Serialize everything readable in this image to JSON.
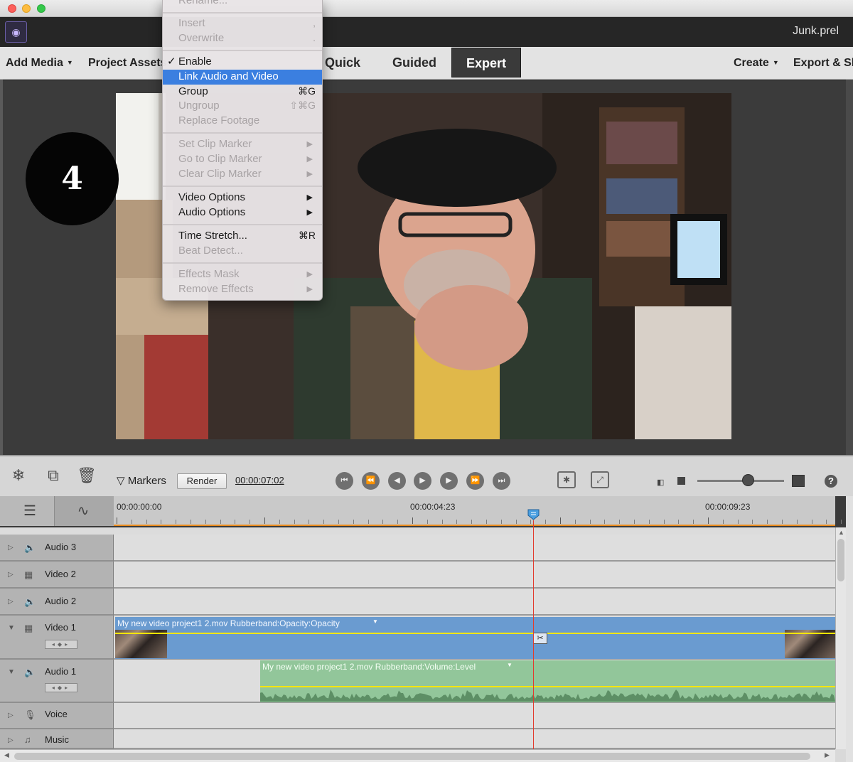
{
  "window": {
    "project_name": "Junk.prel"
  },
  "menubar": {
    "add_media": "Add Media",
    "project_assets": "Project Assets",
    "modes": [
      "Quick",
      "Guided",
      "Expert"
    ],
    "active_mode": "Expert",
    "create": "Create",
    "export": "Export & Share"
  },
  "step_badge": "4",
  "context_menu": {
    "items": [
      {
        "label": "Rename...",
        "shortcut": "",
        "enabled": false
      },
      {
        "label": "Insert",
        "shortcut": ",",
        "enabled": false
      },
      {
        "label": "Overwrite",
        "shortcut": ".",
        "enabled": false
      },
      {
        "label": "Enable",
        "shortcut": "",
        "enabled": true,
        "checked": true
      },
      {
        "label": "Link Audio and Video",
        "shortcut": "",
        "enabled": true,
        "highlighted": true
      },
      {
        "label": "Group",
        "shortcut": "⌘G",
        "enabled": true
      },
      {
        "label": "Ungroup",
        "shortcut": "⇧⌘G",
        "enabled": false
      },
      {
        "label": "Replace Footage",
        "shortcut": "",
        "enabled": false
      },
      {
        "label": "Set Clip Marker",
        "submenu": true,
        "enabled": false
      },
      {
        "label": "Go to Clip Marker",
        "submenu": true,
        "enabled": false
      },
      {
        "label": "Clear Clip Marker",
        "submenu": true,
        "enabled": false
      },
      {
        "label": "Video Options",
        "submenu": true,
        "enabled": true
      },
      {
        "label": "Audio Options",
        "submenu": true,
        "enabled": true
      },
      {
        "label": "Time Stretch...",
        "shortcut": "⌘R",
        "enabled": true
      },
      {
        "label": "Beat Detect...",
        "shortcut": "",
        "enabled": false
      },
      {
        "label": "Effects Mask",
        "submenu": true,
        "enabled": false
      },
      {
        "label": "Remove Effects",
        "submenu": true,
        "enabled": false
      }
    ]
  },
  "controls": {
    "markers_label": "Markers",
    "render_label": "Render",
    "timecode": "00:00:07:02",
    "zoom_level": 0.58
  },
  "ruler": {
    "labels": [
      "00:00:00:00",
      "00:00:04:23",
      "00:00:09:23"
    ]
  },
  "tracks": [
    {
      "name": "Audio 3",
      "kind": "audio"
    },
    {
      "name": "Video 2",
      "kind": "video"
    },
    {
      "name": "Audio 2",
      "kind": "audio"
    },
    {
      "name": "Video 1",
      "kind": "video",
      "expanded": true
    },
    {
      "name": "Audio 1",
      "kind": "audio",
      "expanded": true
    },
    {
      "name": "Voice",
      "kind": "voice"
    },
    {
      "name": "Music",
      "kind": "music"
    }
  ],
  "clips": {
    "video_title": "My new video project1 2.mov Rubberband:Opacity:Opacity",
    "audio_title": "My new video project1 2.mov Rubberband:Volume:Level"
  },
  "icons": {
    "app_logo": "premiere-elements-logo-icon",
    "freeze": "snowflake-icon",
    "rotate": "rotate-icon",
    "delete": "trash-icon",
    "markers": "marker-icon",
    "help": "help-icon"
  }
}
